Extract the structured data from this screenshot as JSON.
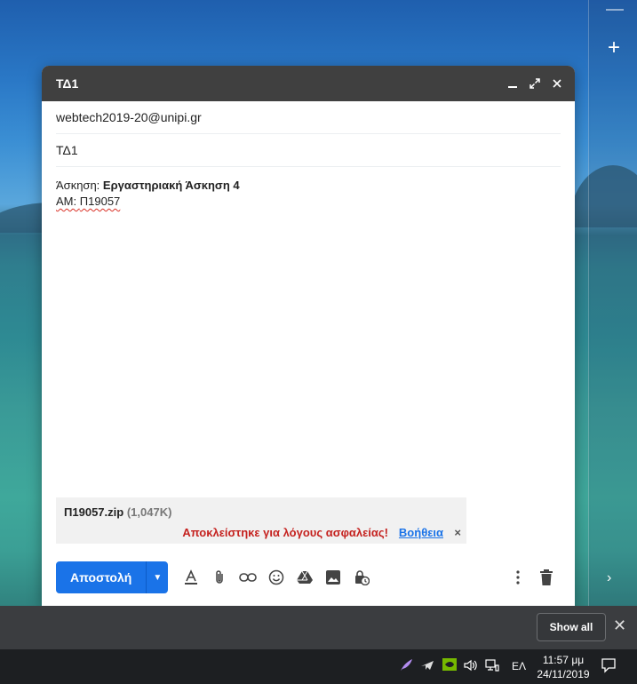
{
  "compose": {
    "title": "ΤΔ1",
    "to": "webtech2019-20@unipi.gr",
    "subject": "ΤΔ1",
    "body": {
      "line1_label": "Άσκηση: ",
      "line1_value": "Εργαστηριακή Άσκηση 4",
      "line2_label": "ΑΜ: ",
      "line2_value": "Π19057"
    },
    "attachment": {
      "name": "Π19057.zip",
      "size": "(1,047K)",
      "warning": "Αποκλείστηκε για λόγους ασφαλείας!",
      "help": "Βοήθεια",
      "close": "×"
    },
    "send_label": "Αποστολή"
  },
  "download_bar": {
    "show_all": "Show all",
    "close": "✕"
  },
  "taskbar": {
    "language": "ΕΛ",
    "time": "11:57 μμ",
    "date": "24/11/2019"
  },
  "colors": {
    "accent": "#1a73e8",
    "warning": "#c5221f",
    "compose_header": "#404040"
  }
}
